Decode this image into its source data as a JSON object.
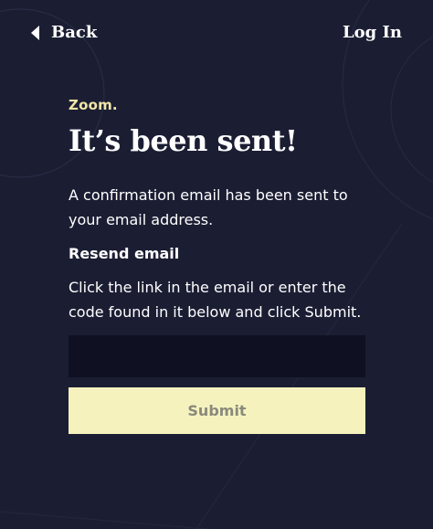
{
  "nav": {
    "back_label": "Back",
    "login_label": "Log In"
  },
  "main": {
    "brand": "Zoom.",
    "title": "It’s been sent!",
    "confirmation": "A confirmation email has been sent to your email address.",
    "resend_heading": "Resend email",
    "instructions": "Click the link in the email or enter the code found in it below and click Submit.",
    "code_input": {
      "value": "",
      "placeholder": ""
    },
    "submit_label": "Submit"
  },
  "colors": {
    "background": "#1b1e33",
    "brand_accent": "#f0e6a8",
    "input_background": "#0f1021",
    "button_background": "#f5f2be",
    "button_text": "#8a8a7c"
  },
  "icons": {
    "back": "triangle-left-icon"
  }
}
